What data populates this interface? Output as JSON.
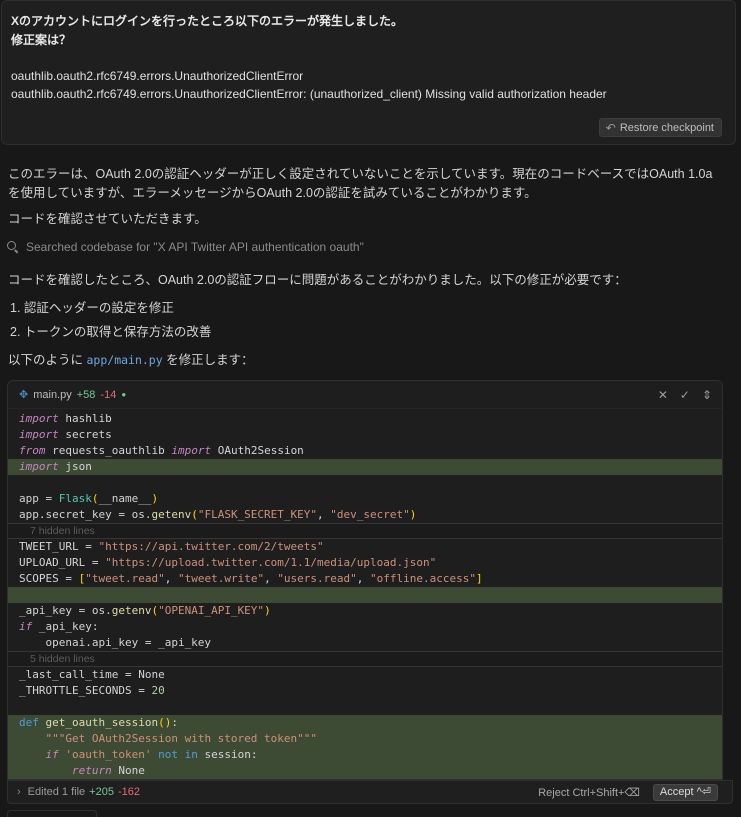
{
  "user_message": {
    "line1": "Xのアカウントにログインを行ったところ以下のエラーが発生しました。",
    "line2": "修正案は？",
    "error1": "oauthlib.oauth2.rfc6749.errors.UnauthorizedClientError",
    "error2": "oauthlib.oauth2.rfc6749.errors.UnauthorizedClientError: (unauthorized_client) Missing valid authorization header",
    "restore_label": "Restore checkpoint"
  },
  "assistant": {
    "para1": "このエラーは、OAuth 2.0の認証ヘッダーが正しく設定されていないことを示しています。現在のコードベースではOAuth 1.0aを使用していますが、エラーメッセージからOAuth 2.0の認証を試みていることがわかります。",
    "para2": "コードを確認させていただきます。",
    "searched": "Searched codebase for \"X API Twitter API authentication oauth\"",
    "para3": "コードを確認したところ、OAuth 2.0の認証フローに問題があることがわかりました。以下の修正が必要です：",
    "list": [
      "1. 認証ヘッダーの設定を修正",
      "2. トークンの取得と保存方法の改善"
    ],
    "para4_pre": "以下のように",
    "para4_code": "app/main.py",
    "para4_post": "を修正します："
  },
  "editor": {
    "filename": "main.py",
    "added": "+58",
    "removed": "-14",
    "hidden1": "7 hidden lines",
    "hidden2": "5 hidden lines"
  },
  "bottom": {
    "chevron": "›",
    "edited": "Edited 1 file",
    "added": "+205",
    "removed": "-162",
    "reject": "Reject Ctrl+Shift+⌫",
    "accept": "Accept ^⏎"
  }
}
